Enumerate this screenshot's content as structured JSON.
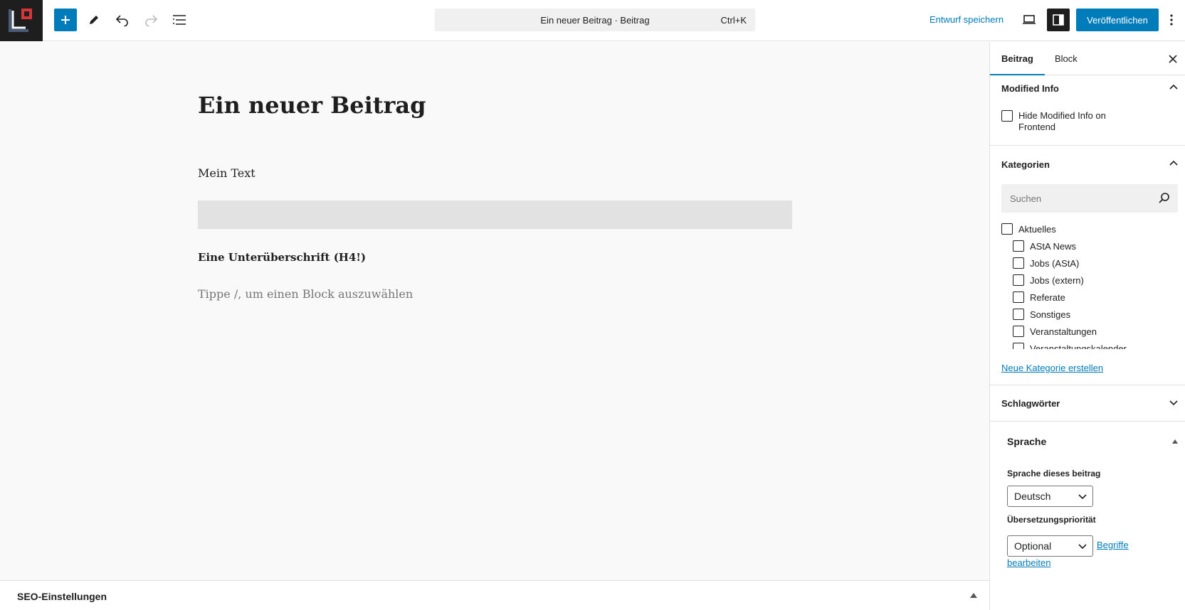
{
  "toolbar": {
    "command_title": "Ein neuer Beitrag · Beitrag",
    "command_shortcut": "Ctrl+K",
    "save_draft": "Entwurf speichern",
    "publish": "Veröffentlichen"
  },
  "editor": {
    "title": "Ein neuer Beitrag",
    "paragraph": "Mein Text",
    "heading": "Eine Unterüberschrift (H4!)",
    "placeholder": "Tippe /, um einen Block auszuwählen"
  },
  "seo": {
    "label": "SEO-Einstellungen"
  },
  "sidebar": {
    "tabs": [
      "Beitrag",
      "Block"
    ],
    "modified_info": {
      "title": "Modified Info",
      "checkbox_line1": "Hide Modified Info on",
      "checkbox_line2": "Frontend"
    },
    "categories": {
      "title": "Kategorien",
      "search_placeholder": "Suchen",
      "items": [
        "Aktuelles",
        "AStA News",
        "Jobs (AStA)",
        "Jobs (extern)",
        "Referate",
        "Sonstiges",
        "Veranstaltungen",
        "Veranstaltungskalender"
      ],
      "new_link": "Neue Kategorie erstellen"
    },
    "tags": {
      "title": "Schlagwörter"
    },
    "language": {
      "title": "Sprache",
      "post_language_label": "Sprache dieses beitrag",
      "post_language_value": "Deutsch",
      "priority_label": "Übersetzungspriorität",
      "priority_value": "Optional",
      "edit_terms_line1": "Begriffe",
      "edit_terms_line2": "bearbeiten"
    }
  },
  "colors": {
    "accent": "#007cba",
    "dark": "#1e1e1e",
    "logo_red": "#d63638"
  }
}
